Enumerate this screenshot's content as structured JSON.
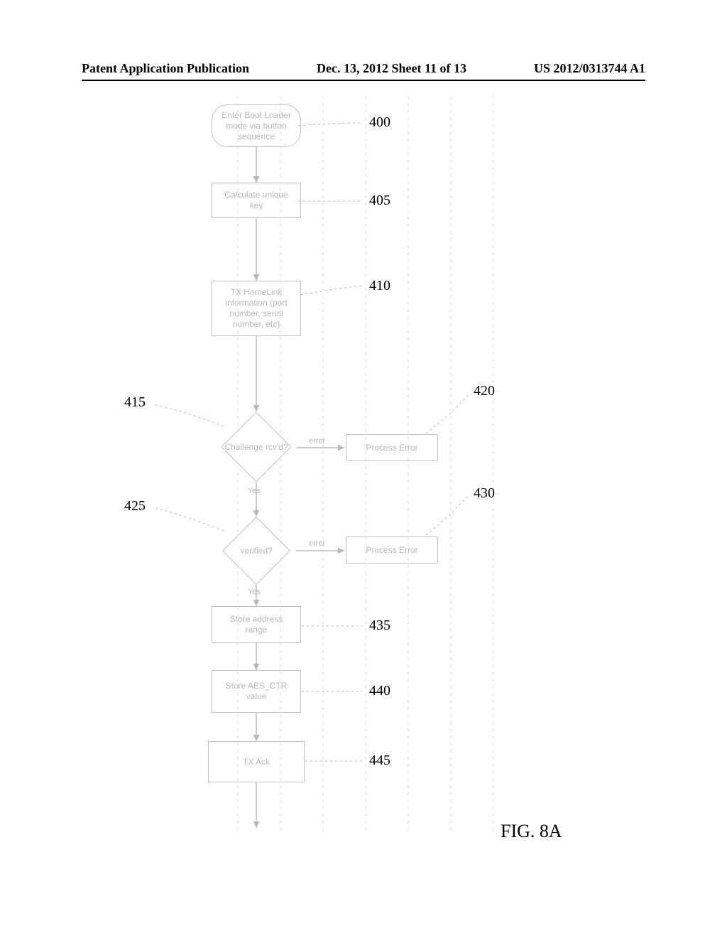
{
  "header": {
    "left": "Patent Application Publication",
    "center": "Dec. 13, 2012  Sheet 11 of 13",
    "right": "US 2012/0313744 A1"
  },
  "nodes": {
    "n400": {
      "text": "Enter Boot Loader mode via button sequence",
      "ref": "400"
    },
    "n405": {
      "text": "Calculate unique key",
      "ref": "405"
    },
    "n410": {
      "text": "TX HomeLink information (part number, serial number, etc)",
      "ref": "410"
    },
    "n415": {
      "text": "Challenge rcv'd?",
      "ref": "415"
    },
    "n420": {
      "text": "Process Error",
      "ref": "420"
    },
    "n425": {
      "text": "verified?",
      "ref": "425"
    },
    "n430": {
      "text": "Process Error",
      "ref": "430"
    },
    "n435": {
      "text": "Store address range",
      "ref": "435"
    },
    "n440": {
      "text": "Store AES_CTR value",
      "ref": "440"
    },
    "n445": {
      "text": "TX Ack",
      "ref": "445"
    }
  },
  "edge_labels": {
    "yes1": "Yes",
    "yes2": "Yes",
    "err1": "error",
    "err2": "error"
  },
  "figure_label": "FIG. 8A",
  "chart_data": {
    "type": "flowchart",
    "title": "FIG. 8A",
    "nodes": [
      {
        "id": "400",
        "shape": "terminator",
        "text": "Enter Boot Loader mode via button sequence"
      },
      {
        "id": "405",
        "shape": "process",
        "text": "Calculate unique key"
      },
      {
        "id": "410",
        "shape": "process",
        "text": "TX HomeLink information (part number, serial number, etc)"
      },
      {
        "id": "415",
        "shape": "decision",
        "text": "Challenge rcv'd?"
      },
      {
        "id": "420",
        "shape": "process",
        "text": "Process Error"
      },
      {
        "id": "425",
        "shape": "decision",
        "text": "verified?"
      },
      {
        "id": "430",
        "shape": "process",
        "text": "Process Error"
      },
      {
        "id": "435",
        "shape": "process",
        "text": "Store address range"
      },
      {
        "id": "440",
        "shape": "process",
        "text": "Store AES_CTR value"
      },
      {
        "id": "445",
        "shape": "process",
        "text": "TX Ack"
      }
    ],
    "edges": [
      {
        "from": "400",
        "to": "405"
      },
      {
        "from": "405",
        "to": "410"
      },
      {
        "from": "410",
        "to": "415"
      },
      {
        "from": "415",
        "to": "420",
        "label": "error"
      },
      {
        "from": "415",
        "to": "425",
        "label": "Yes"
      },
      {
        "from": "425",
        "to": "430",
        "label": "error"
      },
      {
        "from": "425",
        "to": "435",
        "label": "Yes"
      },
      {
        "from": "435",
        "to": "440"
      },
      {
        "from": "440",
        "to": "445"
      },
      {
        "from": "445",
        "to": "continuation"
      }
    ]
  }
}
